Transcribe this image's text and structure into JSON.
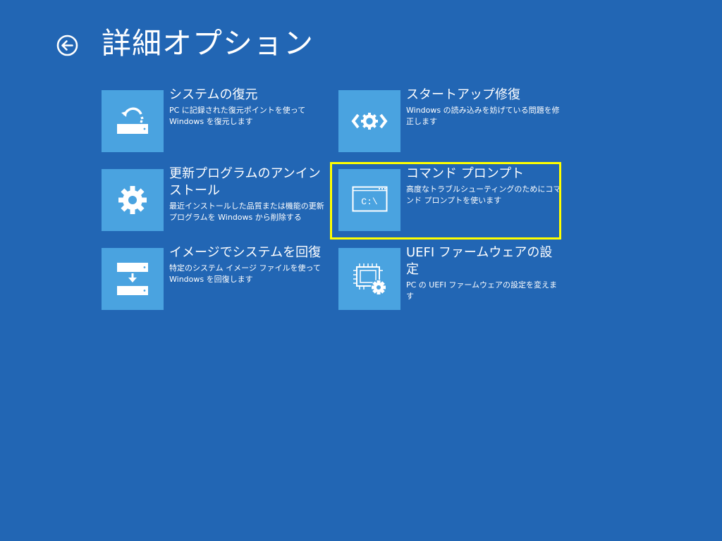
{
  "header": {
    "back_icon": "back-arrow-icon",
    "title": "詳細オプション"
  },
  "tiles": [
    {
      "title": "システムの復元",
      "description": "PC に記録された復元ポイントを使って Windows を復元します",
      "icon": "system-restore-icon"
    },
    {
      "title": "スタートアップ修復",
      "description": "Windows の読み込みを妨げている問題を修正します",
      "icon": "startup-repair-icon"
    },
    {
      "title": "更新プログラムのアンインストール",
      "description": "最近インストールした品質または機能の更新プログラムを Windows から削除する",
      "icon": "gear-icon"
    },
    {
      "title": "コマンド プロンプト",
      "description": "高度なトラブルシューティングのためにコマンド プロンプトを使います",
      "icon": "command-prompt-icon",
      "icon_text": "C:\\"
    },
    {
      "title": "イメージでシステムを回復",
      "description": "特定のシステム イメージ ファイルを使って Windows を回復します",
      "icon": "system-image-recovery-icon"
    },
    {
      "title": "UEFI ファームウェアの設定",
      "description": "PC の UEFI ファームウェアの設定を変えます",
      "icon": "firmware-settings-icon"
    }
  ],
  "colors": {
    "background": "#2266b4",
    "tile": "#4aa3e0",
    "highlight": "#ffff00",
    "text": "#ffffff"
  }
}
